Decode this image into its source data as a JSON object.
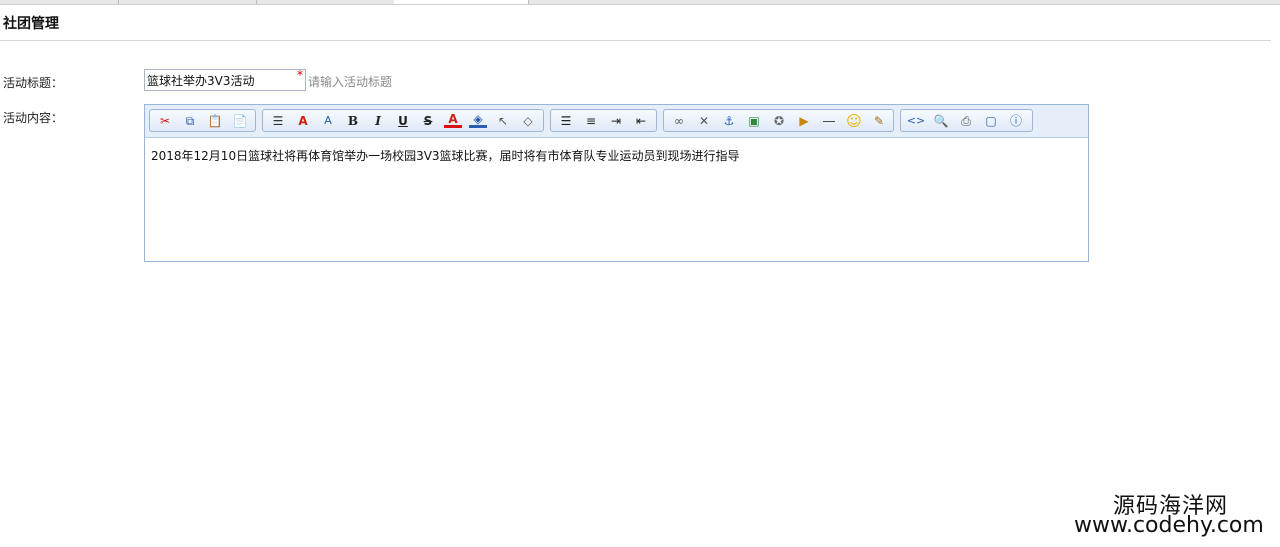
{
  "page": {
    "title": "社团管理"
  },
  "form": {
    "activity_title_label": "活动标题：",
    "activity_title_value": "篮球社举办3V3活动",
    "required_mark": "*",
    "activity_title_hint": "请输入活动标题",
    "activity_content_label": "活动内容："
  },
  "editor": {
    "toolbar_groups": [
      [
        "cut-icon",
        "copy-icon",
        "paste-icon",
        "paste-text-icon"
      ],
      [
        "font-family-icon",
        "font-size-icon",
        "text-style-icon",
        "bold-icon",
        "italic-icon",
        "underline-icon",
        "strikethrough-icon",
        "font-color-icon",
        "highlight-color-icon",
        "select-all-icon",
        "remove-format-icon"
      ],
      [
        "justify-icon",
        "ordered-list-icon",
        "indent-icon",
        "outdent-icon"
      ],
      [
        "link-icon",
        "unlink-icon",
        "anchor-icon",
        "image-icon",
        "flash-icon",
        "media-icon",
        "horizontal-rule-icon",
        "emoticon-icon",
        "insert-template-icon"
      ],
      [
        "source-code-icon",
        "preview-icon",
        "print-icon",
        "fullscreen-icon",
        "about-icon"
      ]
    ],
    "content": "2018年12月10日篮球社将再体育馆举办一场校园3V3篮球比赛，届时将有市体育队专业运动员到现场进行指导"
  },
  "watermark": {
    "line1": "源码海洋网",
    "line2": "www.codehy.com"
  }
}
